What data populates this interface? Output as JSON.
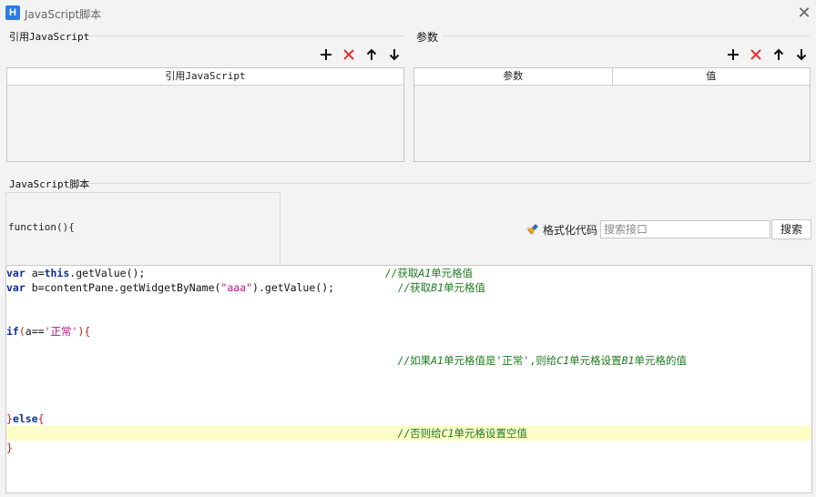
{
  "window": {
    "title": "JavaScript脚本",
    "app_icon": "H"
  },
  "ref_section": {
    "label": "引用JavaScript",
    "column_header": "引用JavaScript",
    "toolbar": {
      "add_icon": "plus-icon",
      "delete_icon": "x-icon",
      "up_icon": "arrow-up-icon",
      "down_icon": "arrow-down-icon"
    }
  },
  "params_section": {
    "label": "参数",
    "columns": [
      "参数",
      "值"
    ],
    "toolbar": {
      "add_icon": "plus-icon",
      "delete_icon": "x-icon",
      "up_icon": "arrow-up-icon",
      "down_icon": "arrow-down-icon"
    }
  },
  "script_section": {
    "label": "JavaScript脚本",
    "function_header": "function(){",
    "format_label": "格式化代码",
    "search_placeholder": "搜索接口",
    "search_button": "搜索"
  },
  "colors": {
    "highlight_line": "#fdfdc6",
    "keyword": "#0b2fa0",
    "string": "#b5168c",
    "comment": "#1f7a1f",
    "delete": "#e03030"
  },
  "code": {
    "line1": {
      "kw": "var",
      "rest1": " a=",
      "kw2": "this",
      "rest2": ".getValue();",
      "pad": "                                      ",
      "comment_pre": "//获取",
      "comment_cell": "A1",
      "comment_post": "单元格值"
    },
    "line2": {
      "kw": "var",
      "rest": " b=contentPane.getWidgetByName(",
      "str": "\"aaa\"",
      "rest2": ").getValue();",
      "pad": "          ",
      "comment_pre": "//获取",
      "comment_cell": "B1",
      "comment_post": "单元格值"
    },
    "line5": {
      "kw": "if",
      "p1": "(",
      "id": "a==",
      "str": "'正常'",
      "p2": "){"
    },
    "line7": {
      "pad": "                                                              ",
      "c1": "//如果",
      "c2": "A1",
      "c3": "单元格值是'正常',则给",
      "c4": "C1",
      "c5": "单元格设置",
      "c6": "B1",
      "c7": "单元格的值"
    },
    "line11": {
      "p1": "}",
      "kw": "else",
      "p2": "{"
    },
    "line12": {
      "pad": "                                                              ",
      "c1": "//否则给",
      "c2": "C1",
      "c3": "单元格设置空值"
    },
    "line13": {
      "p1": "}"
    }
  }
}
